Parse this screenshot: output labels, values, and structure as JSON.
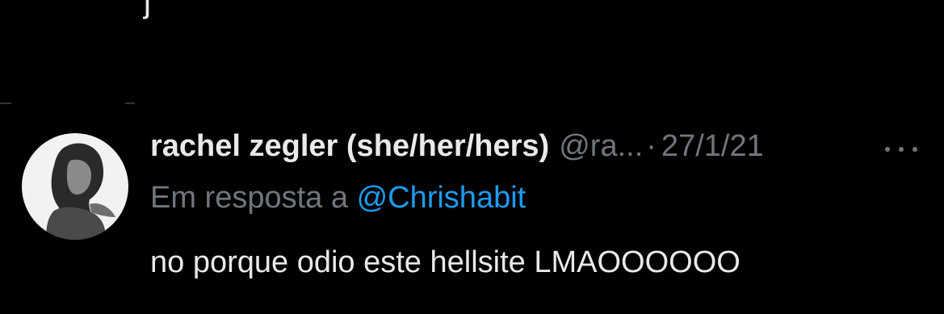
{
  "top": {
    "cropped_glyph": "j"
  },
  "tweet": {
    "author": {
      "display_name": "rachel zegler (she/her/hers)",
      "handle": "@ra...",
      "avatar_icon": "profile-photo"
    },
    "separator": "·",
    "date": "27/1/21",
    "more_icon": "more-horizontal-icon",
    "reply_context": {
      "prefix": "Em resposta a",
      "mention": "@Chrishabit"
    },
    "text": "no porque odio este hellsite LMAOOOOOO"
  },
  "colors": {
    "background": "#000000",
    "primary_text": "#e7e9ea",
    "secondary_text": "#71767b",
    "link": "#1d9bf0",
    "divider": "#2f3336"
  }
}
